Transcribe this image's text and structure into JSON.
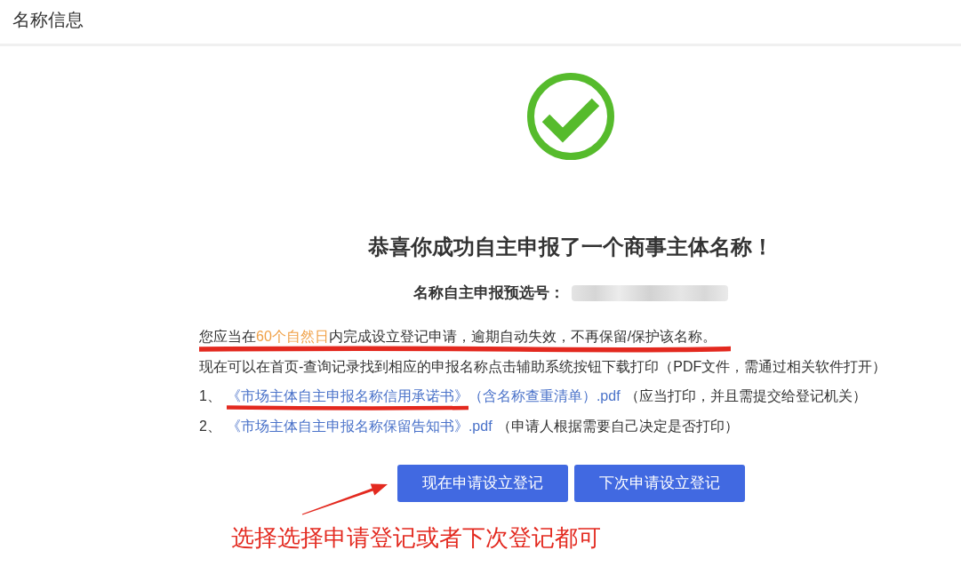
{
  "header": {
    "title": "名称信息"
  },
  "result": {
    "title": "恭喜你成功自主申报了一个商事主体名称！",
    "preselection_label": "名称自主申报预选号："
  },
  "notice": {
    "segments": [
      {
        "text": "您应当在",
        "kind": "plain"
      },
      {
        "text": "60个自然日",
        "kind": "highlight"
      },
      {
        "text": "内完成设立登记申请，逾期自动失效，不再保留/保护该名称。",
        "kind": "plain"
      }
    ],
    "underlined": true
  },
  "instruction": "现在可以在首页-查询记录找到相应的申报名称点击辅助系统按钮下载打印（PDF文件，需通过相关软件打开）",
  "documents": [
    {
      "index": "1、",
      "link_title": "《市场主体自主申报名称信用承诺书》",
      "link_suffix": "（含名称查重清单）.pdf",
      "note": "（应当打印，并且需提交给登记机关）",
      "underlined": true
    },
    {
      "index": "2、",
      "link_title": "《市场主体自主申报名称保留告知书》",
      "link_suffix": ".pdf",
      "note": "（申请人根据需要自己决定是否打印）",
      "underlined": false
    }
  ],
  "buttons": [
    {
      "label": "现在申请设立登记"
    },
    {
      "label": "下次申请设立登记"
    }
  ],
  "annotation": {
    "text": "选择选择申请登记或者下次登记都可"
  }
}
